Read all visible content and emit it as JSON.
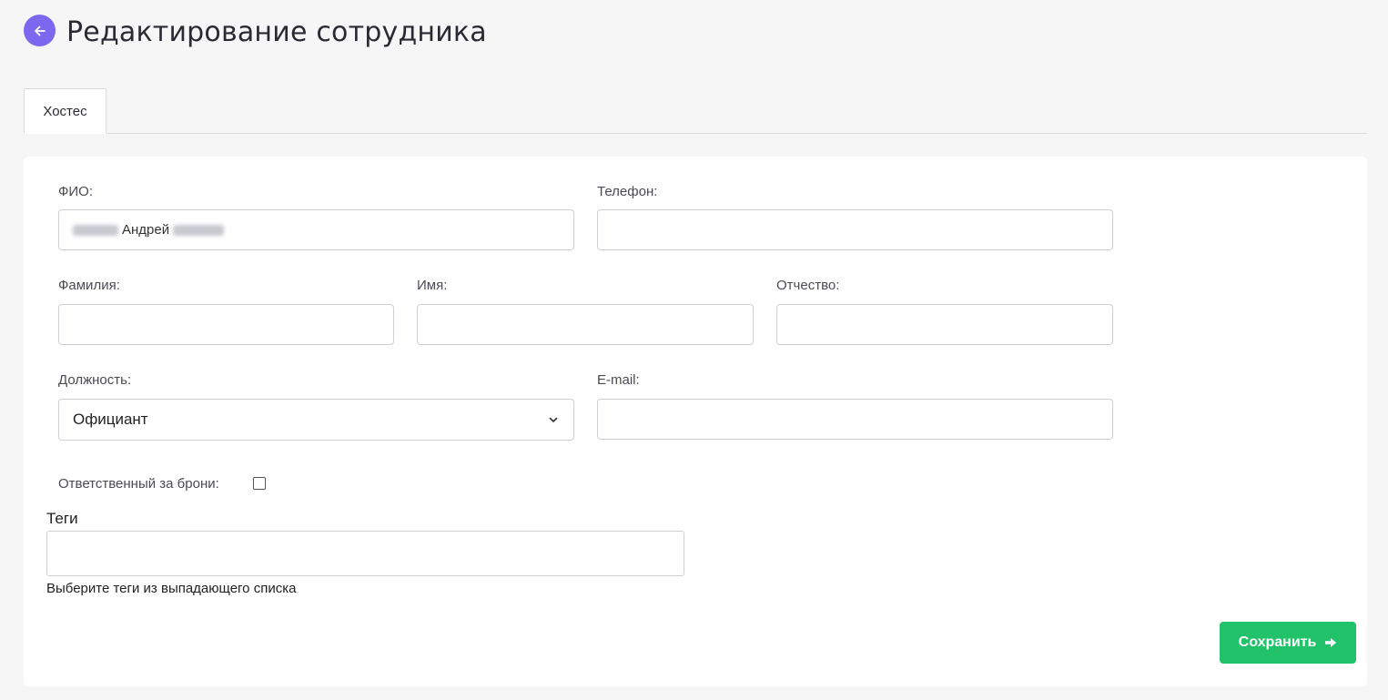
{
  "header": {
    "title": "Редактирование сотрудника",
    "back_icon": "arrow-left-icon"
  },
  "tabs": [
    {
      "label": "Хостес",
      "active": true
    }
  ],
  "form": {
    "fio": {
      "label": "ФИО:",
      "value_visible": "Андрей"
    },
    "phone": {
      "label": "Телефон:",
      "value": ""
    },
    "last_name": {
      "label": "Фамилия:",
      "value": ""
    },
    "first_name": {
      "label": "Имя:",
      "value": ""
    },
    "patronymic": {
      "label": "Отчество:",
      "value": ""
    },
    "position": {
      "label": "Должность:",
      "value": "Официант"
    },
    "email": {
      "label": "E-mail:",
      "value": ""
    },
    "responsible": {
      "label": "Ответственный за брони:",
      "checked": false
    },
    "tags": {
      "label": "Теги",
      "hint": "Выберите теги из выпадающего списка"
    }
  },
  "actions": {
    "save_label": "Сохранить"
  },
  "colors": {
    "accent": "#7b68ee",
    "save": "#22c26b",
    "background": "#f6f6f6"
  }
}
